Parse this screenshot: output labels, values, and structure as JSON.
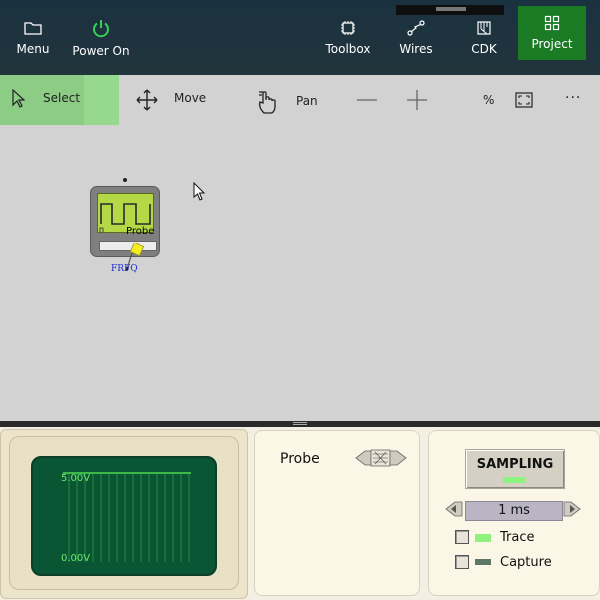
{
  "topbar": {
    "menu": "Menu",
    "power": "Power On",
    "toolbox": "Toolbox",
    "wires": "Wires",
    "cdk": "CDK",
    "project": "Project"
  },
  "tools": {
    "select": "Select",
    "move": "Move",
    "pan": "Pan",
    "zoom_percent": "%",
    "more": "···"
  },
  "component": {
    "label": "Probe",
    "pin_label": "FRFQ"
  },
  "scope": {
    "top_voltage": "5.00V",
    "bottom_voltage": "0.00V"
  },
  "probe_panel": {
    "name": "Probe"
  },
  "sampling": {
    "title": "SAMPLING",
    "interval": "1 ms",
    "trace": "Trace",
    "capture": "Capture"
  },
  "colors": {
    "accent": "#1b7a24",
    "power_icon": "#34d058",
    "selected_tool": "#97d88f",
    "screen": "#0a5634",
    "trace": "#6de86d"
  }
}
